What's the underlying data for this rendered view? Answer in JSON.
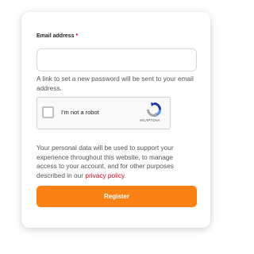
{
  "form": {
    "email_label": "Email address",
    "required_marker": "*",
    "email_value": "",
    "email_placeholder": "",
    "help_text": "A link to set a new password will be sent to your email address.",
    "recaptcha": {
      "checkbox_label": "I'm not a robot",
      "brand": "reCAPTCHA",
      "checked": false,
      "logo_icon": "recaptcha-logo-icon"
    },
    "privacy_text": "Your personal data will be used to support your experience throughout this website, to manage access to your account, and for other purposes described in our ",
    "privacy_link": "privacy policy",
    "privacy_suffix": ".",
    "register_label": "Register"
  },
  "colors": {
    "accent": "#fa8215",
    "required": "#d0021b",
    "link": "#d0021b"
  }
}
